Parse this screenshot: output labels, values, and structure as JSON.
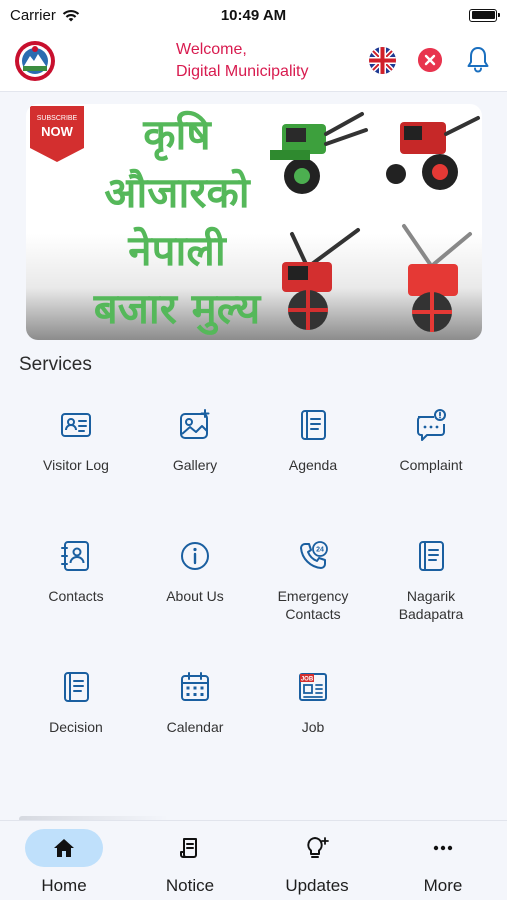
{
  "status_bar": {
    "carrier": "Carrier",
    "time": "10:49 AM"
  },
  "header": {
    "welcome_line1": "Welcome,",
    "welcome_line2": "Digital Municipality",
    "accent_color": "#d81b4f"
  },
  "banner": {
    "badge_top": "SUBSCRIBE",
    "badge_bottom": "NOW",
    "lines": [
      "कृषि",
      "औजारको",
      "नेपाली",
      "बजार मुल्य"
    ]
  },
  "services": {
    "title": "Services",
    "items": [
      {
        "label": "Visitor Log",
        "icon": "visitor-log-icon"
      },
      {
        "label": "Gallery",
        "icon": "gallery-icon"
      },
      {
        "label": "Agenda",
        "icon": "agenda-icon"
      },
      {
        "label": "Complaint",
        "icon": "complaint-icon"
      },
      {
        "label": "Contacts",
        "icon": "contacts-icon"
      },
      {
        "label": "About Us",
        "icon": "info-icon"
      },
      {
        "label": "Emergency Contacts",
        "icon": "emergency-24-icon"
      },
      {
        "label": "Nagarik Badapatra",
        "icon": "nagarik-badapatra-icon"
      },
      {
        "label": "Decision",
        "icon": "decision-icon"
      },
      {
        "label": "Calendar",
        "icon": "calendar-icon"
      },
      {
        "label": "Job",
        "icon": "job-icon"
      }
    ]
  },
  "tabs": [
    {
      "label": "Home",
      "icon": "home-icon",
      "active": true
    },
    {
      "label": "Notice",
      "icon": "notice-icon",
      "active": false
    },
    {
      "label": "Updates",
      "icon": "bulb-icon",
      "active": false
    },
    {
      "label": "More",
      "icon": "more-dots-icon",
      "active": false
    }
  ],
  "colors": {
    "icon_blue": "#1a5fa0",
    "tab_active_bg": "#bfe0fb",
    "close_red": "#e8344e"
  }
}
